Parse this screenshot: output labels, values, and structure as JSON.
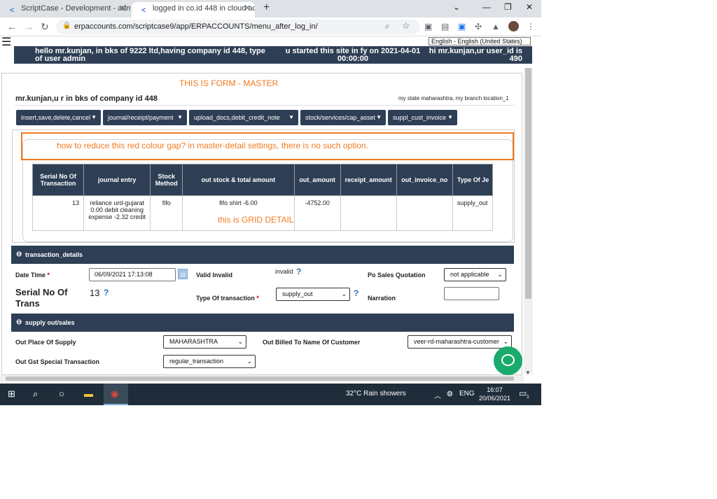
{
  "browser": {
    "tabs": [
      {
        "title": "ScriptCase - Development - adm"
      },
      {
        "title": "logged in co.id 448 in cloud acc"
      }
    ],
    "url": "erpaccounts.com/scriptcase9/app/ERPACCOUNTS/menu_after_log_in/",
    "language_select": "English - English (United States)"
  },
  "topbar": {
    "greeting": "hello mr.kunjan, in bks of 9222 ltd,having company id 448, type of user admin",
    "started": "u started this site in fy on 2021-04-01 00:00:00",
    "user_id": "hi mr.kunjan,ur user_id is 490"
  },
  "annotations": {
    "form_title": "THIS IS FORM - MASTER",
    "gap_question": "how to reduce this red colour gap? in master-detail settings, there is no such option.",
    "grid_label": "this is GRID DETAIL"
  },
  "header": {
    "company": "mr.kunjan,u r in bks of company id 448",
    "state_branch": "my state maharashtra, my branch location_1"
  },
  "menu": [
    {
      "label": "insert,save,delete,cancel"
    },
    {
      "label": "journal/receipt/payment"
    },
    {
      "label": "upload_docs,debit_credit_note"
    },
    {
      "label": "stock/services/cap_asset"
    },
    {
      "label": "suppl_cust_invoice"
    }
  ],
  "grid": {
    "columns": [
      "Serial No Of Transaction",
      "journal entry",
      "Stock Method",
      "out stock & total amount",
      "out_amount",
      "receipt_amount",
      "out_invoice_no",
      "Type Of Je"
    ],
    "rows": [
      [
        "13",
        "reliance urd-gujarat 0.00 debit cleaning expense -2.32 credit",
        "fifo",
        "fifo shirt -6.00",
        "-4752.00",
        "",
        "",
        "supply_out"
      ]
    ]
  },
  "transaction_details": {
    "section_title": "transaction_details",
    "date_time_label": "Date Time",
    "date_time_value": "06/09/2021 17:13:08",
    "valid_label": "Valid Invalid",
    "valid_value": "invalid",
    "po_label": "Po Sales Quotation",
    "po_value": "not applicable",
    "serial_label": "Serial No Of Trans",
    "serial_value": "13",
    "type_label": "Type Of transaction",
    "type_value": "supply_out",
    "narration_label": "Narration",
    "narration_value": ""
  },
  "supply": {
    "section_title": "supply out/sales",
    "place_label": "Out Place Of Supply",
    "place_value": "MAHARASHTRA",
    "billed_label": "Out Billed To Name Of Customer",
    "billed_value": "veer-rd-maharashtra-customer",
    "gst_label": "Out Gst Special Transaction",
    "gst_value": "regular_transaction"
  },
  "taskbar": {
    "weather": "32°C  Rain showers",
    "lang": "ENG",
    "time": "16:07",
    "date": "20/06/2021",
    "notif_count": "1"
  },
  "colors": {
    "navy": "#2e3f55",
    "annotation": "#f07b22",
    "chat": "#1aaa6e"
  }
}
